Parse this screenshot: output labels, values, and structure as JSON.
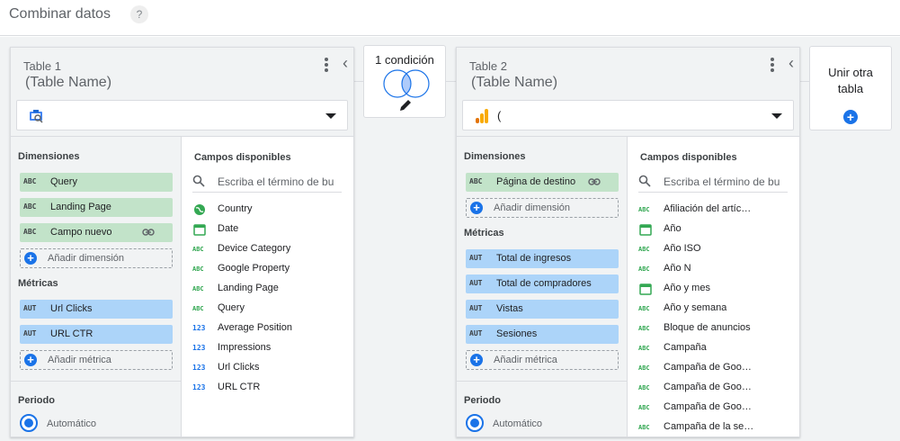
{
  "header": {
    "title": "Combinar datos",
    "help_symbol": "?"
  },
  "tables": [
    {
      "label": "Table 1",
      "name": "(Table Name)",
      "source": {
        "icon": "search-console-icon",
        "text": ""
      },
      "dimensions_label": "Dimensiones",
      "dimensions": [
        {
          "type": "ABC",
          "name": "Query",
          "linked": false
        },
        {
          "type": "ABC",
          "name": "Landing Page",
          "linked": false
        },
        {
          "type": "ABC",
          "name": "Campo nuevo",
          "linked": true
        }
      ],
      "add_dimension": "Añadir dimensión",
      "metrics_label": "Métricas",
      "metrics": [
        {
          "type": "AUT",
          "name": "Url Clicks"
        },
        {
          "type": "AUT",
          "name": "URL CTR"
        }
      ],
      "add_metric": "Añadir métrica",
      "period_label": "Periodo",
      "period_option": "Automático",
      "available_title": "Campos disponibles",
      "search_placeholder": "Escriba el término de bu",
      "fields": [
        {
          "icon": "globe",
          "type": "geo",
          "name": "Country"
        },
        {
          "icon": "calendar",
          "type": "date",
          "name": "Date"
        },
        {
          "icon": "abc",
          "type": "ABC",
          "name": "Device Category"
        },
        {
          "icon": "abc",
          "type": "ABC",
          "name": "Google Property"
        },
        {
          "icon": "abc",
          "type": "ABC",
          "name": "Landing Page"
        },
        {
          "icon": "abc",
          "type": "ABC",
          "name": "Query"
        },
        {
          "icon": "num",
          "type": "123",
          "name": "Average Position"
        },
        {
          "icon": "num",
          "type": "123",
          "name": "Impressions"
        },
        {
          "icon": "num",
          "type": "123",
          "name": "Url Clicks"
        },
        {
          "icon": "num",
          "type": "123",
          "name": "URL CTR"
        }
      ]
    },
    {
      "label": "Table 2",
      "name": "(Table Name)",
      "source": {
        "icon": "google-analytics-icon",
        "text": "("
      },
      "dimensions_label": "Dimensiones",
      "dimensions": [
        {
          "type": "ABC",
          "name": "Página de destino",
          "linked": true
        }
      ],
      "add_dimension": "Añadir dimensión",
      "metrics_label": "Métricas",
      "metrics": [
        {
          "type": "AUT",
          "name": "Total de ingresos"
        },
        {
          "type": "AUT",
          "name": "Total de compradores"
        },
        {
          "type": "AUT",
          "name": "Vistas"
        },
        {
          "type": "AUT",
          "name": "Sesiones"
        }
      ],
      "add_metric": "Añadir métrica",
      "period_label": "Periodo",
      "period_option": "Automático",
      "available_title": "Campos disponibles",
      "search_placeholder": "Escriba el término de bu",
      "fields": [
        {
          "icon": "abc",
          "type": "ABC",
          "name": "Afiliación del artíc…"
        },
        {
          "icon": "calendar",
          "type": "date",
          "name": "Año"
        },
        {
          "icon": "abc",
          "type": "ABC",
          "name": "Año ISO"
        },
        {
          "icon": "abc",
          "type": "ABC",
          "name": "Año N"
        },
        {
          "icon": "calendar",
          "type": "date",
          "name": "Año y mes"
        },
        {
          "icon": "abc",
          "type": "ABC",
          "name": "Año y semana"
        },
        {
          "icon": "abc",
          "type": "ABC",
          "name": "Bloque de anuncios"
        },
        {
          "icon": "abc",
          "type": "ABC",
          "name": "Campaña"
        },
        {
          "icon": "abc",
          "type": "ABC",
          "name": "Campaña de Goo…"
        },
        {
          "icon": "abc",
          "type": "ABC",
          "name": "Campaña de Goo…"
        },
        {
          "icon": "abc",
          "type": "ABC",
          "name": "Campaña de Goo…"
        },
        {
          "icon": "abc",
          "type": "ABC",
          "name": "Campaña de la se…"
        }
      ]
    }
  ],
  "join_condition": {
    "label": "1 condición"
  },
  "join_another": {
    "label_line1": "Unir otra",
    "label_line2": "tabla"
  },
  "colors": {
    "dimension_chip": "#c2e3c9",
    "metric_chip": "#acd4f9",
    "accent": "#1a73e8",
    "text_field_icon": "#34a853",
    "analytics_orange": "#f9ab00"
  }
}
